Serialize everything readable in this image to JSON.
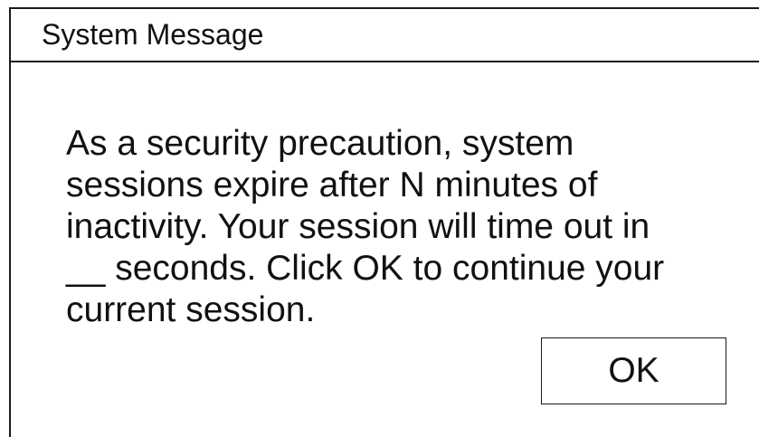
{
  "dialog": {
    "title": "System Message",
    "message_lines": [
      "As a security precaution, system",
      "sessions expire after N minutes of",
      "inactivity. Your session will time out in",
      "__ seconds. Click OK to continue your",
      "current session."
    ],
    "ok_label": "OK"
  }
}
